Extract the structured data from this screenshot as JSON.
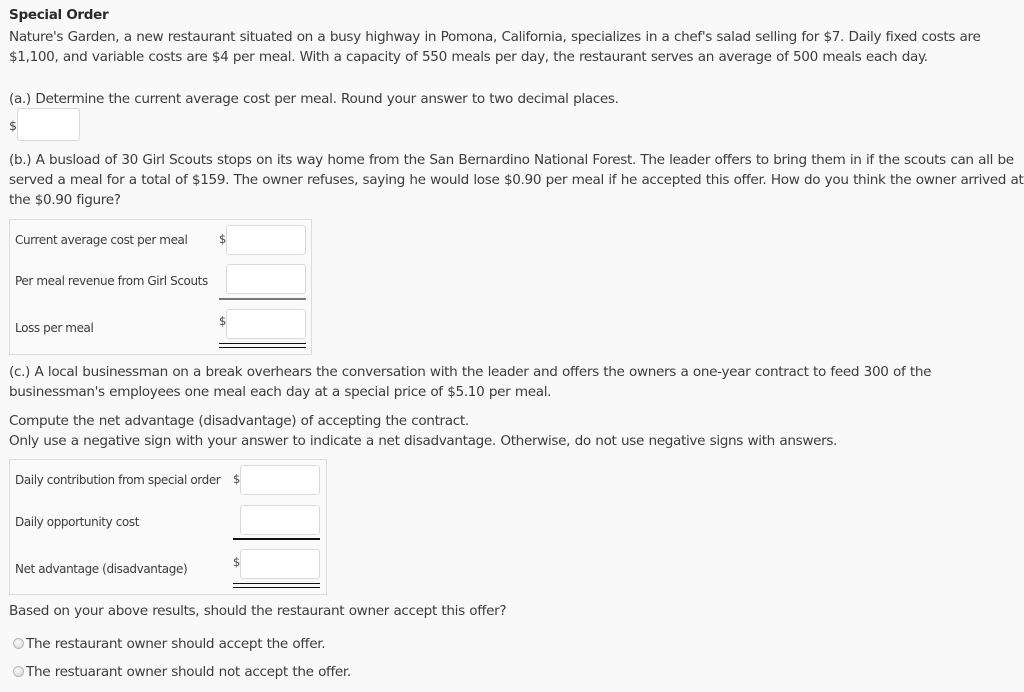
{
  "problem": {
    "title": "Special Order",
    "intro_line1": "Nature's Garden, a new restaurant situated on a busy highway in Pomona, California, specializes in a chef's salad selling for $7. Daily fixed costs are",
    "intro_line2": "$1,100, and variable costs are $4 per meal. With a capacity of 550 meals per day, the restaurant serves an average of 500 meals each day."
  },
  "part_a": {
    "question": "(a.) Determine the current average cost per meal. Round your answer to two decimal places.",
    "currency": "$",
    "answer": ""
  },
  "part_b": {
    "line1": "(b.) A busload of 30 Girl Scouts stops on its way home from the San Bernardino National Forest. The leader offers to bring them in if the scouts can all be",
    "line2": "served a meal for a total of $159. The owner refuses, saying he would lose $0.90 per meal if he accepted this offer. How do you think the owner arrived at",
    "line3": "the $0.90 figure?",
    "rows": [
      {
        "label": "Current average cost per meal",
        "currency": "$",
        "value": ""
      },
      {
        "label": "Per meal revenue from Girl Scouts",
        "currency": "",
        "value": ""
      },
      {
        "label": "Loss per meal",
        "currency": "$",
        "value": ""
      }
    ]
  },
  "part_c": {
    "line1": "(c.) A local businessman on a break overhears the conversation with the leader and offers the owners a one-year contract to feed 300 of the",
    "line2": "businessman's employees one meal each day at a special price of $5.10 per meal.",
    "instruction1": "Compute the net advantage (disadvantage) of accepting the contract.",
    "instruction2": "Only use a negative sign with your answer to indicate a net disadvantage. Otherwise, do not use negative signs with answers.",
    "rows": [
      {
        "label": "Daily contribution from special order",
        "currency": "$",
        "value": ""
      },
      {
        "label": "Daily opportunity cost",
        "currency": "",
        "value": ""
      },
      {
        "label": "Net advantage (disadvantage)",
        "currency": "$",
        "value": ""
      }
    ],
    "decision_question": "Based on your above results, should the restaurant owner accept this offer?",
    "options": [
      {
        "label": "The restaurant owner should accept the offer.",
        "selected": false
      },
      {
        "label": "The restuarant owner should not accept the offer.",
        "selected": false
      }
    ]
  }
}
